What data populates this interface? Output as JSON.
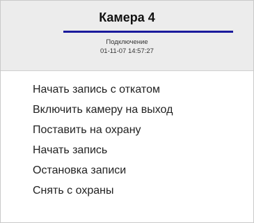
{
  "menu": {
    "title": "Камера 4",
    "status": "Подключение",
    "timestamp": "01-11-07 14:57:27",
    "accent_color": "#1a1a9c",
    "items": [
      {
        "label": "Начать запись с откатом"
      },
      {
        "label": "Включить камеру на выход"
      },
      {
        "label": "Поставить на охрану"
      },
      {
        "label": "Начать запись"
      },
      {
        "label": "Остановка записи"
      },
      {
        "label": "Снять с охраны"
      }
    ]
  }
}
